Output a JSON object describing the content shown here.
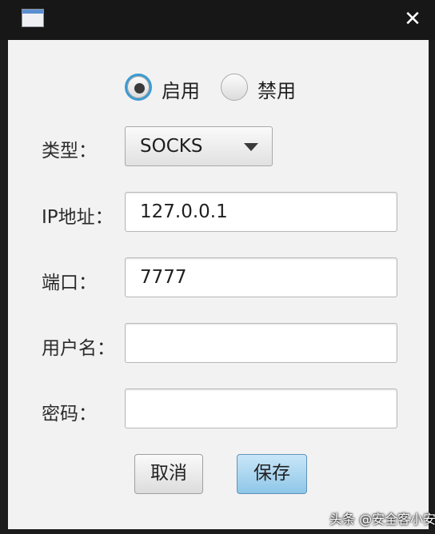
{
  "window": {
    "close_glyph": "✕"
  },
  "mode": {
    "options": [
      {
        "label": "启用",
        "checked": true
      },
      {
        "label": "禁用",
        "checked": false
      }
    ]
  },
  "form": {
    "type_label": "类型：",
    "type_value": "SOCKS",
    "ip_label": "IP地址：",
    "ip_value": "127.0.0.1",
    "port_label": "端口：",
    "port_value": "7777",
    "username_label": "用户名：",
    "username_value": "",
    "password_label": "密码：",
    "password_value": ""
  },
  "buttons": {
    "cancel": "取消",
    "save": "保存"
  },
  "watermark": "头条 @安全客小安",
  "colors": {
    "focus": "#3c9bd3",
    "save_button": "#9fcfed",
    "titlebar": "#171717"
  }
}
